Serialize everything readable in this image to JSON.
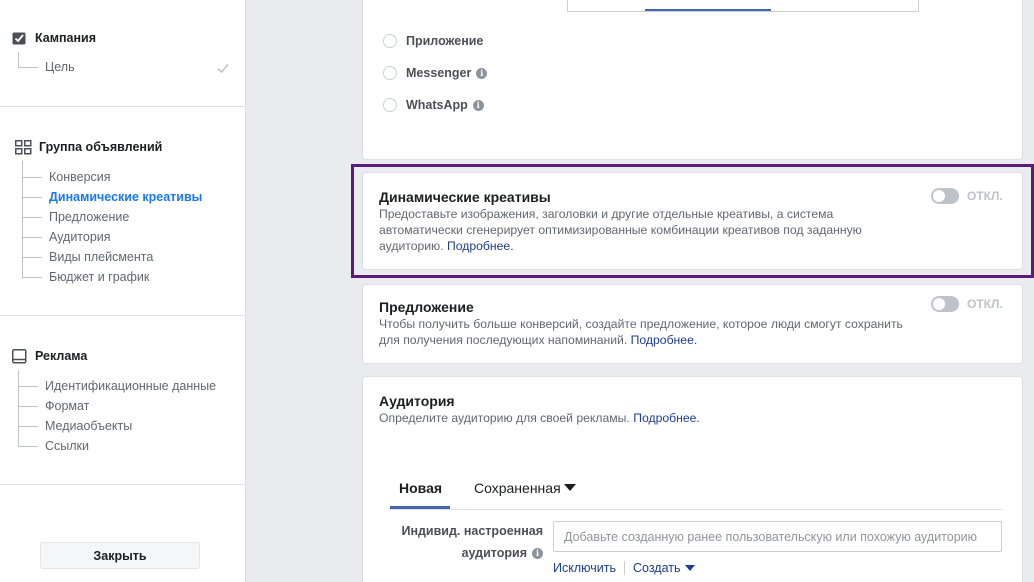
{
  "sidebar": {
    "campaign": {
      "title": "Кампания",
      "icon": "checkbox-icon",
      "items": [
        {
          "label": "Цель",
          "done": true
        }
      ]
    },
    "adset": {
      "title": "Группа объявлений",
      "icon": "grid-icon",
      "items": [
        {
          "label": "Конверсия"
        },
        {
          "label": "Динамические креативы",
          "active": true
        },
        {
          "label": "Предложение"
        },
        {
          "label": "Аудитория"
        },
        {
          "label": "Виды плейсмента"
        },
        {
          "label": "Бюджет и график"
        }
      ]
    },
    "ad": {
      "title": "Реклама",
      "icon": "tablet-icon",
      "items": [
        {
          "label": "Идентификационные данные"
        },
        {
          "label": "Формат"
        },
        {
          "label": "Медиаобъекты"
        },
        {
          "label": "Ссылки"
        }
      ]
    },
    "close_label": "Закрыть"
  },
  "destination": {
    "options": [
      {
        "label": "Приложение",
        "info": false
      },
      {
        "label": "Messenger",
        "info": true
      },
      {
        "label": "WhatsApp",
        "info": true
      }
    ]
  },
  "dynamic_creative": {
    "title": "Динамические креативы",
    "description": "Предоставьте изображения, заголовки и другие отдельные креативы, а система автоматически сгенерирует оптимизированные комбинации креативов под заданную аудиторию.",
    "link": "Подробнее.",
    "toggle_label": "ОТКЛ.",
    "enabled": false
  },
  "offer": {
    "title": "Предложение",
    "description": "Чтобы получить больше конверсий, создайте предложение, которое люди смогут сохранить для получения последующих напоминаний.",
    "link": "Подробнее.",
    "toggle_label": "ОТКЛ.",
    "enabled": false
  },
  "audience": {
    "title": "Аудитория",
    "description": "Определите аудиторию для своей рекламы.",
    "link": "Подробнее.",
    "tabs": [
      {
        "label": "Новая",
        "active": true
      },
      {
        "label": "Сохраненная",
        "active": false
      }
    ],
    "custom_label_line1": "Индивид. настроенная",
    "custom_label_line2": "аудитория",
    "custom_placeholder": "Добавьте созданную ранее пользовательскую или похожую аудиторию",
    "exclude_label": "Исключить",
    "create_label": "Создать"
  },
  "colors": {
    "accent": "#1877f2",
    "link": "#1d3d8f",
    "highlight_border": "#5c1a7a"
  }
}
